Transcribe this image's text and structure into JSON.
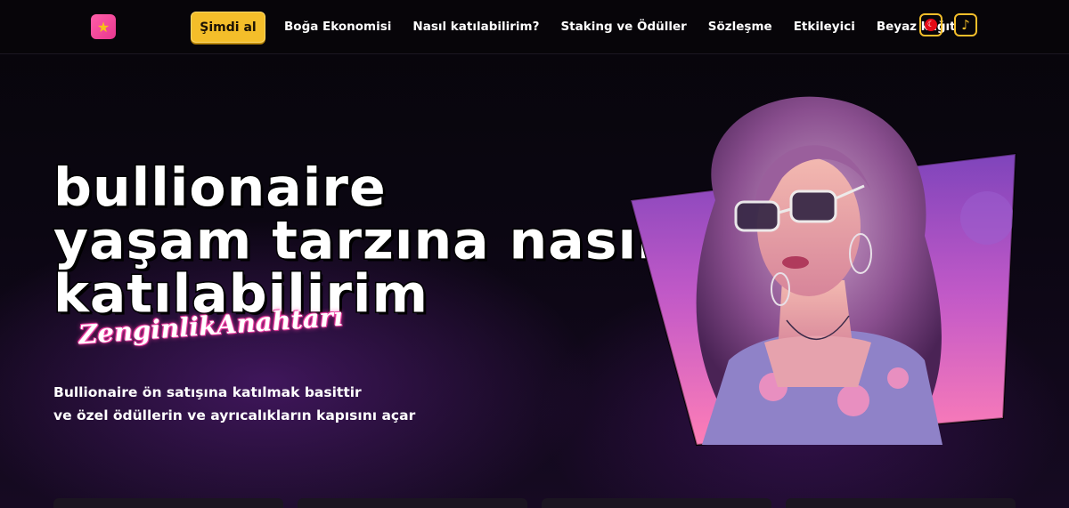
{
  "header": {
    "logo_icon": "star-icon",
    "buy_label": "Şimdi al",
    "nav": [
      "Boğa Ekonomisi",
      "Nasıl katılabilirim?",
      "Staking ve Ödüller",
      "Sözleşme",
      "Etkileyici",
      "Beyaz kağıt"
    ],
    "language_icon": "turkey-flag-icon",
    "music_icon": "music-note-icon",
    "accent": "#f4be2a"
  },
  "hero": {
    "title_lines": [
      "bullionaire",
      "yaşam tarzına nasıl",
      "katılabilirim"
    ],
    "script_word": "ZenginlikAnahtarı",
    "subtitle_lines": [
      "Bullionaire ön satışına katılmak basittir",
      "ve özel ödüllerin ve ayrıcalıkların kapısını açar"
    ],
    "image_label": "woman-with-sunglasses-illustration"
  },
  "colors": {
    "background": "#050308",
    "purple_glow": "#7828aa",
    "pink": "#ff3fa8"
  }
}
